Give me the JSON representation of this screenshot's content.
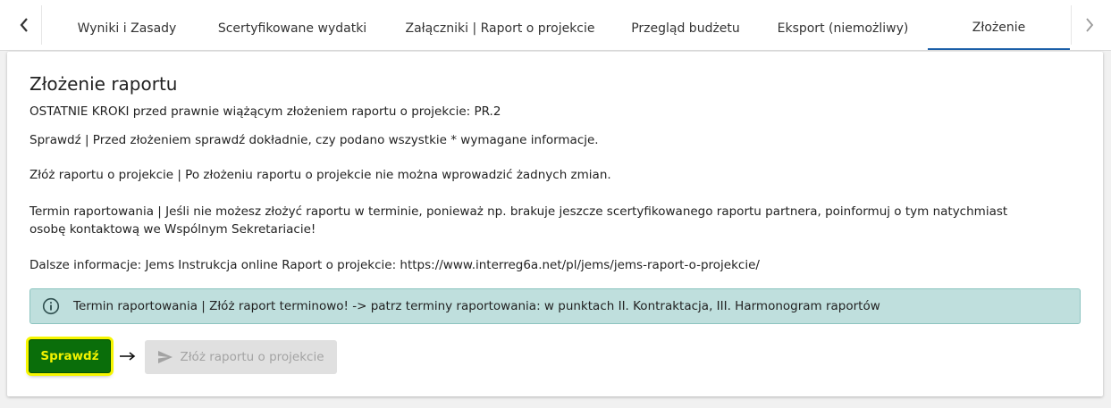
{
  "tabs": [
    {
      "label": "Wyniki i Zasady",
      "active": false
    },
    {
      "label": "Scertyfikowane wydatki",
      "active": false
    },
    {
      "label": "Załączniki | Raport o projekcie",
      "active": false
    },
    {
      "label": "Przegląd budżetu",
      "active": false
    },
    {
      "label": "Eksport (niemożliwy)",
      "active": false
    },
    {
      "label": "Złożenie",
      "active": true
    }
  ],
  "tab_icons": {
    "prev": "chevron-left-icon",
    "next": "chevron-right-icon"
  },
  "main": {
    "title": "Złożenie raportu",
    "subtitle": "OSTATNIE KROKI przed prawnie wiążącym złożeniem raportu o projekcie: PR.2",
    "check_text": "Sprawdź | Przed złożeniem sprawdź dokładnie, czy podano wszystkie * wymagane informacje.",
    "submit_text": "Złóż raportu o projekcie | Po złożeniu raportu o projekcie nie można wprowadzić żadnych zmian.",
    "deadline_text": "Termin raportowania | Jeśli nie możesz złożyć raportu w terminie, ponieważ np. brakuje jeszcze scertyfikowanego raportu partnera, poinformuj o tym natychmiast osobę kontaktową we Wspólnym Sekretariacie!",
    "info_text": "Dalsze informacje: Jems Instrukcja online Raport o projekcie: https://www.interreg6a.net/pl/jems/jems-raport-o-projekcie/"
  },
  "alert": {
    "icon": "info-circle-icon",
    "text": "Termin raportowania | Złóż raport terminowo! -> patrz terminy raportowania: w punktach II. Kontraktacja, III. Harmonogram raportów"
  },
  "actions": {
    "check_label": "Sprawdź",
    "submit_label": "Złóż raportu o projekcie",
    "submit_icon": "send-icon",
    "arrow_icon": "arrow-right-icon",
    "submit_disabled": true
  },
  "colors": {
    "tab_active_underline": "#1b5fa8",
    "alert_bg": "#bfdfdd",
    "check_button_bg": "#0a6e0a",
    "check_button_text": "#f3f300",
    "highlight": "#f6f600",
    "disabled_bg": "#e0e0e0"
  }
}
